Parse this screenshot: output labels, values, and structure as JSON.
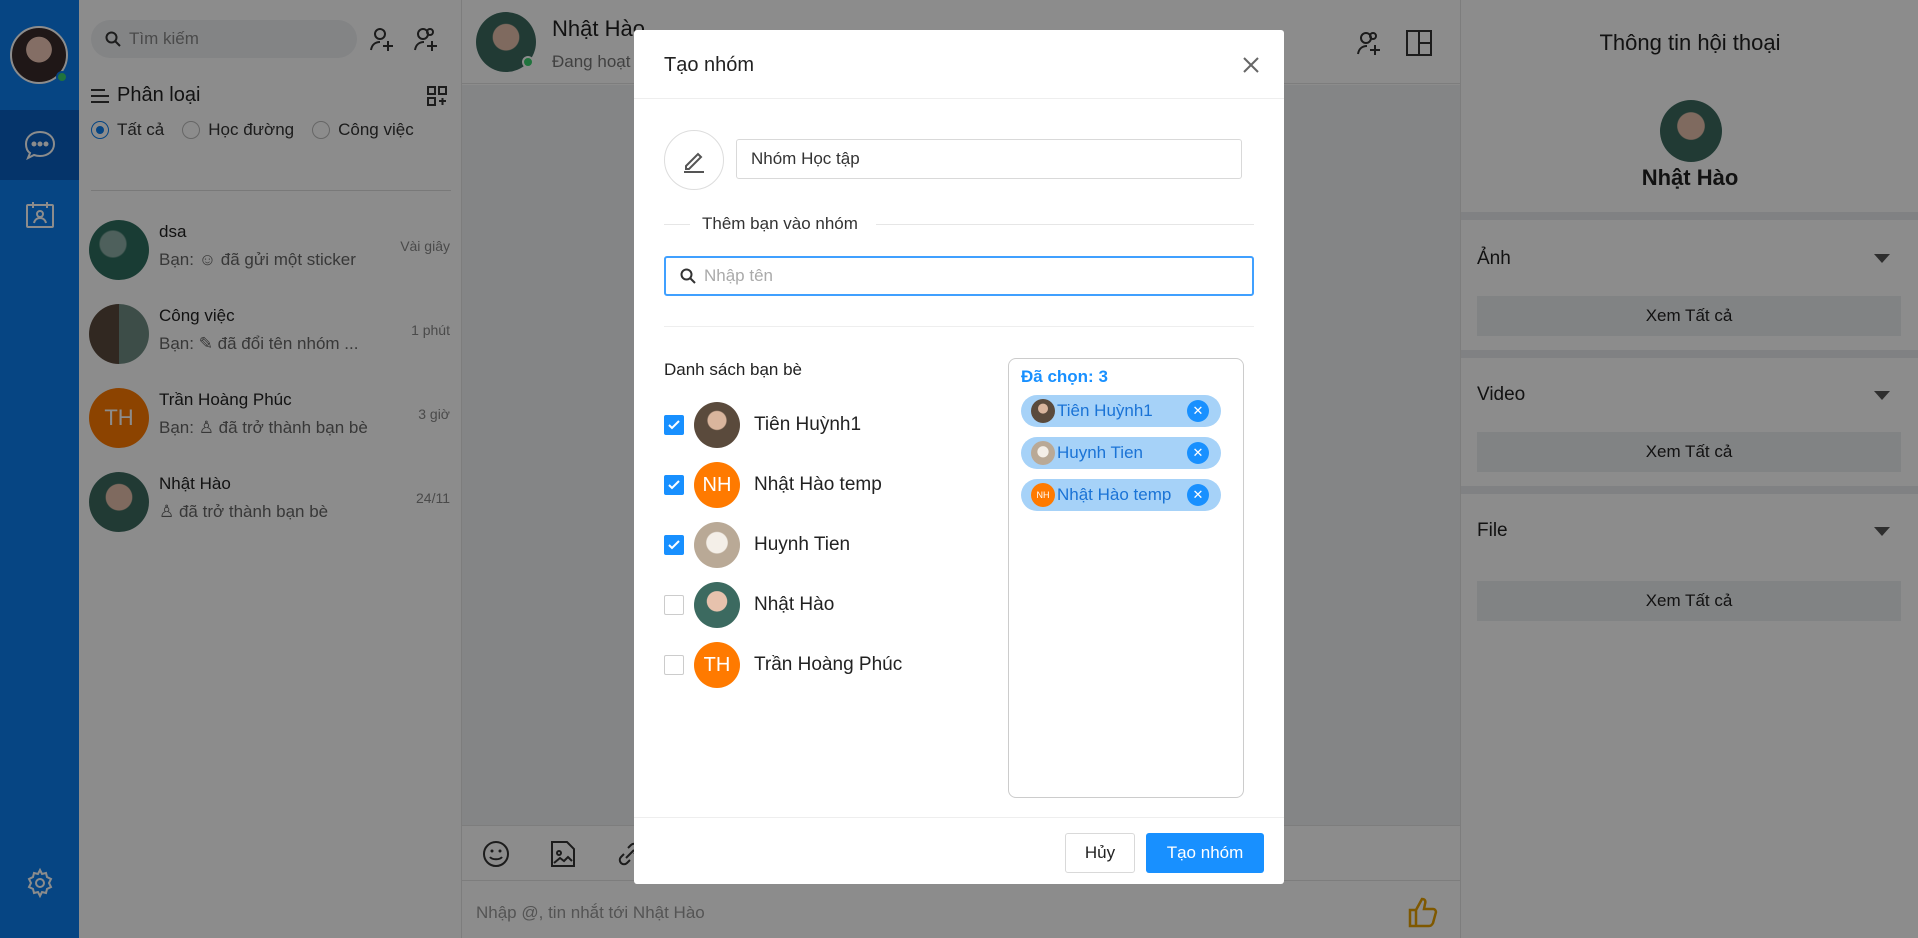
{
  "sidebar": {
    "nav_items": [
      "chat-icon",
      "contacts-icon"
    ],
    "settings_icon": "gear-icon"
  },
  "list": {
    "search_placeholder": "Tìm kiếm",
    "category_title": "Phân loại",
    "filters": [
      {
        "label": "Tất cả",
        "checked": true
      },
      {
        "label": "Học đường",
        "checked": false
      },
      {
        "label": "Công việc",
        "checked": false
      }
    ],
    "conversations": [
      {
        "name": "dsa",
        "message": "Bạn: ☺ đã gửi một sticker",
        "time": "Vài giây",
        "avatar_text": "",
        "avatar_color": "#2f6d5f"
      },
      {
        "name": "Công việc",
        "message": "Bạn: ✎ đã đổi tên nhóm ...",
        "time": "1 phút",
        "avatar_text": "",
        "avatar_color": "#7a5b4c"
      },
      {
        "name": "Trần Hoàng Phúc",
        "message": "Bạn: ♙ đã trở thành bạn bè",
        "time": "3 giờ",
        "avatar_text": "TH",
        "avatar_color": "#ff7a00"
      },
      {
        "name": "Nhật Hào",
        "message": "♙ đã trở thành bạn bè",
        "time": "24/11",
        "avatar_text": "",
        "avatar_color": "#3c6a60"
      }
    ]
  },
  "chat": {
    "name": "Nhật Hào",
    "status": "Đang hoạt",
    "composer_placeholder": "Nhập @, tin nhắt tới Nhật Hào"
  },
  "info": {
    "title": "Thông tin hội thoại",
    "name": "Nhật Hào",
    "sections": [
      {
        "label": "Ảnh",
        "button": "Xem Tất cả"
      },
      {
        "label": "Video",
        "button": "Xem Tất cả"
      },
      {
        "label": "File",
        "button": "Xem Tất cả"
      }
    ]
  },
  "modal": {
    "title": "Tạo nhóm",
    "group_name_value": "Nhóm Học tập",
    "add_friends_label": "Thêm bạn vào nhóm",
    "search_placeholder": "Nhập tên",
    "friends_title": "Danh sách bạn bè",
    "friends": [
      {
        "name": "Tiên Huỳnh1",
        "checked": true,
        "avatar_text": "",
        "avatar_color": "#5a4a3c"
      },
      {
        "name": "Nhật Hào temp",
        "checked": true,
        "avatar_text": "NH",
        "avatar_color": "#ff7a00"
      },
      {
        "name": "Huynh Tien",
        "checked": true,
        "avatar_text": "",
        "avatar_color": "#c9c2ba"
      },
      {
        "name": "Nhật Hào",
        "checked": false,
        "avatar_text": "",
        "avatar_color": "#3c6a60"
      },
      {
        "name": "Trần Hoàng Phúc",
        "checked": false,
        "avatar_text": "TH",
        "avatar_color": "#ff7a00"
      }
    ],
    "selected_label": "Đã chọn: 3",
    "selected": [
      {
        "name": "Tiên Huỳnh1",
        "avatar_text": "",
        "avatar_color": "#5a4a3c"
      },
      {
        "name": "Huynh Tien",
        "avatar_text": "",
        "avatar_color": "#c9c2ba"
      },
      {
        "name": "Nhật Hào temp",
        "avatar_text": "NH",
        "avatar_color": "#ff7a00"
      }
    ],
    "cancel_label": "Hủy",
    "create_label": "Tạo nhóm"
  },
  "colors": {
    "nav": "#0B7FEE",
    "primary": "#1890ff",
    "chip": "#a6d2f8",
    "orange": "#ff7a00"
  }
}
